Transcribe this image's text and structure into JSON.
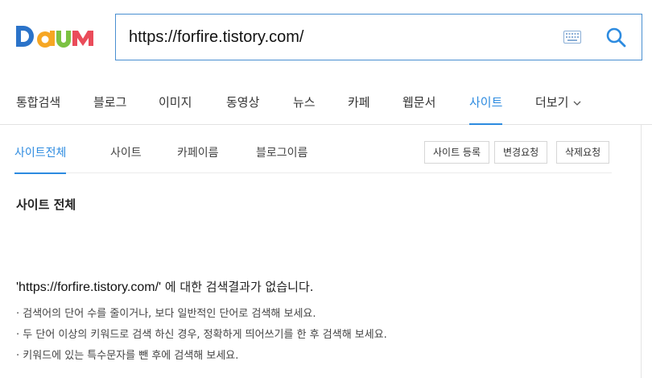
{
  "header": {
    "logo_text": "Daum",
    "search": {
      "value": "https://forfire.tistory.com/"
    },
    "colors": {
      "accent": "#2d8be0",
      "search_border": "#4a8fd1"
    }
  },
  "nav": {
    "tabs": [
      {
        "label": "통합검색"
      },
      {
        "label": "블로그"
      },
      {
        "label": "이미지"
      },
      {
        "label": "동영상"
      },
      {
        "label": "뉴스"
      },
      {
        "label": "카페"
      },
      {
        "label": "웹문서"
      },
      {
        "label": "사이트",
        "active": true
      },
      {
        "label": "더보기"
      }
    ]
  },
  "subnav": {
    "tabs": [
      {
        "label": "사이트전체",
        "active": true
      },
      {
        "label": "사이트"
      },
      {
        "label": "카페이름"
      },
      {
        "label": "블로그이름"
      }
    ],
    "buttons": [
      {
        "label": "사이트 등록"
      },
      {
        "label": "변경요청"
      },
      {
        "label": "삭제요청"
      }
    ]
  },
  "main": {
    "section_title": "사이트 전체",
    "no_result": {
      "query": "'https://forfire.tistory.com/'",
      "message": " 에 대한 검색결과가 없습니다."
    },
    "tips": [
      "· 검색어의 단어 수를 줄이거나, 보다 일반적인 단어로 검색해 보세요.",
      "· 두 단어 이상의 키워드로 검색 하신 경우, 정확하게 띄어쓰기를 한 후 검색해 보세요.",
      "· 키워드에 있는 특수문자를 뺀 후에 검색해 보세요."
    ]
  }
}
